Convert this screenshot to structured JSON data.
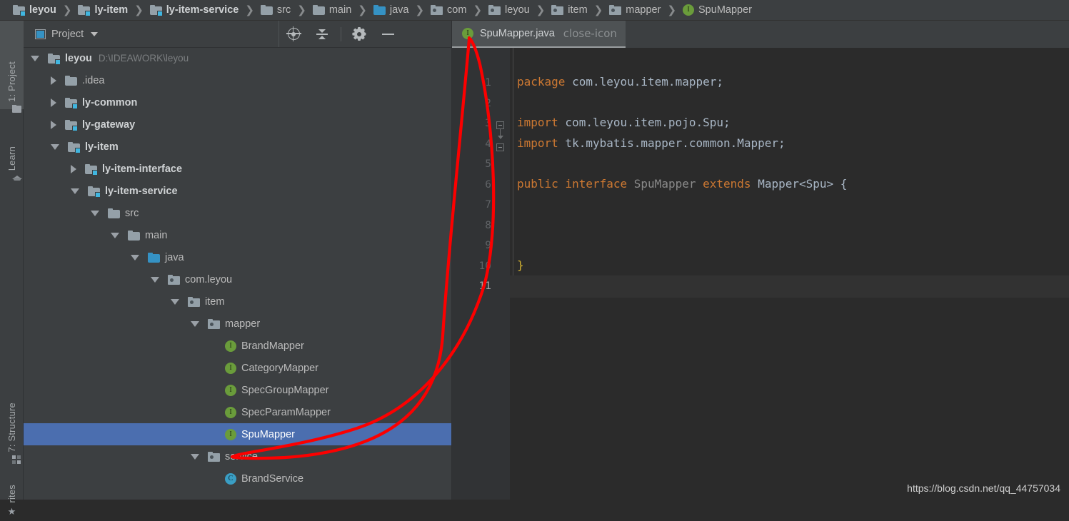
{
  "breadcrumb": [
    {
      "label": "leyou",
      "icon": "module-folder-icon",
      "bold": true
    },
    {
      "label": "ly-item",
      "icon": "module-folder-icon",
      "bold": true
    },
    {
      "label": "ly-item-service",
      "icon": "module-folder-icon",
      "bold": true
    },
    {
      "label": "src",
      "icon": "folder-icon",
      "bold": false
    },
    {
      "label": "main",
      "icon": "folder-icon",
      "bold": false
    },
    {
      "label": "java",
      "icon": "source-folder-icon",
      "bold": false
    },
    {
      "label": "com",
      "icon": "package-icon",
      "bold": false
    },
    {
      "label": "leyou",
      "icon": "package-icon",
      "bold": false
    },
    {
      "label": "item",
      "icon": "package-icon",
      "bold": false
    },
    {
      "label": "mapper",
      "icon": "package-icon",
      "bold": false
    },
    {
      "label": "SpuMapper",
      "icon": "interface-icon",
      "bold": false
    }
  ],
  "tool_strip": {
    "top_tabs": [
      {
        "label": "1: Project",
        "icon": "project-folder-icon",
        "active": true
      },
      {
        "label": "Learn",
        "icon": "graduation-cap-icon",
        "active": false
      }
    ],
    "bottom_tabs": [
      {
        "label": "7: Structure",
        "icon": "structure-icon",
        "active": false
      },
      {
        "label": "rites",
        "icon": "star-icon",
        "active": false
      }
    ]
  },
  "project_panel": {
    "title": "Project",
    "view_icon": "project-window-icon",
    "dropdown_icon": "chevron-down-icon",
    "toolbar": [
      {
        "name": "locate-file-button",
        "icon": "crosshair-icon"
      },
      {
        "name": "collapse-all-button",
        "icon": "collapse-all-icon"
      },
      {
        "name": "settings-button",
        "icon": "gear-icon"
      },
      {
        "name": "hide-button",
        "icon": "minus-icon"
      }
    ],
    "tree": [
      {
        "label": "leyou",
        "path": "D:\\IDEAWORK\\leyou",
        "depth": 0,
        "state": "expanded",
        "icon": "module-folder-icon",
        "bold": true,
        "selected": false
      },
      {
        "label": ".idea",
        "path": "",
        "depth": 1,
        "state": "collapsed",
        "icon": "folder-icon",
        "bold": false,
        "selected": false
      },
      {
        "label": "ly-common",
        "path": "",
        "depth": 1,
        "state": "collapsed",
        "icon": "module-folder-icon",
        "bold": true,
        "selected": false
      },
      {
        "label": "ly-gateway",
        "path": "",
        "depth": 1,
        "state": "collapsed",
        "icon": "module-folder-icon",
        "bold": true,
        "selected": false
      },
      {
        "label": "ly-item",
        "path": "",
        "depth": 1,
        "state": "expanded",
        "icon": "module-folder-icon",
        "bold": true,
        "selected": false
      },
      {
        "label": "ly-item-interface",
        "path": "",
        "depth": 2,
        "state": "collapsed",
        "icon": "module-folder-icon",
        "bold": true,
        "selected": false
      },
      {
        "label": "ly-item-service",
        "path": "",
        "depth": 2,
        "state": "expanded",
        "icon": "module-folder-icon",
        "bold": true,
        "selected": false
      },
      {
        "label": "src",
        "path": "",
        "depth": 3,
        "state": "expanded",
        "icon": "folder-icon",
        "bold": false,
        "selected": false
      },
      {
        "label": "main",
        "path": "",
        "depth": 4,
        "state": "expanded",
        "icon": "folder-icon",
        "bold": false,
        "selected": false
      },
      {
        "label": "java",
        "path": "",
        "depth": 5,
        "state": "expanded",
        "icon": "source-folder-icon",
        "bold": false,
        "selected": false
      },
      {
        "label": "com.leyou",
        "path": "",
        "depth": 6,
        "state": "expanded",
        "icon": "package-icon",
        "bold": false,
        "selected": false
      },
      {
        "label": "item",
        "path": "",
        "depth": 7,
        "state": "expanded",
        "icon": "package-icon",
        "bold": false,
        "selected": false
      },
      {
        "label": "mapper",
        "path": "",
        "depth": 8,
        "state": "expanded",
        "icon": "package-icon",
        "bold": false,
        "selected": false
      },
      {
        "label": "BrandMapper",
        "path": "",
        "depth": 9,
        "state": "leaf",
        "icon": "interface-icon",
        "bold": false,
        "selected": false
      },
      {
        "label": "CategoryMapper",
        "path": "",
        "depth": 9,
        "state": "leaf",
        "icon": "interface-icon",
        "bold": false,
        "selected": false
      },
      {
        "label": "SpecGroupMapper",
        "path": "",
        "depth": 9,
        "state": "leaf",
        "icon": "interface-icon",
        "bold": false,
        "selected": false
      },
      {
        "label": "SpecParamMapper",
        "path": "",
        "depth": 9,
        "state": "leaf",
        "icon": "interface-icon",
        "bold": false,
        "selected": false
      },
      {
        "label": "SpuMapper",
        "path": "",
        "depth": 9,
        "state": "leaf",
        "icon": "interface-icon",
        "bold": false,
        "selected": true
      },
      {
        "label": "service",
        "path": "",
        "depth": 8,
        "state": "expanded",
        "icon": "package-icon",
        "bold": false,
        "selected": false
      },
      {
        "label": "BrandService",
        "path": "",
        "depth": 9,
        "state": "leaf",
        "icon": "class-icon",
        "bold": false,
        "selected": false
      }
    ]
  },
  "editor": {
    "tab": {
      "label": "SpuMapper.java",
      "icon": "interface-icon",
      "close_icon": "close-icon"
    },
    "line_numbers": [
      "1",
      "2",
      "3",
      "4",
      "5",
      "6",
      "7",
      "8",
      "9",
      "10",
      "11"
    ],
    "caret_line": 11,
    "code_lines": [
      {
        "n": 1,
        "tokens": [
          {
            "t": "package",
            "c": "kw"
          },
          {
            "t": " com.leyou.item.mapper;",
            "c": "id"
          }
        ]
      },
      {
        "n": 2,
        "tokens": []
      },
      {
        "n": 3,
        "tokens": [
          {
            "t": "import",
            "c": "kw"
          },
          {
            "t": " com.leyou.item.pojo.Spu;",
            "c": "id"
          }
        ]
      },
      {
        "n": 4,
        "tokens": [
          {
            "t": "import",
            "c": "kw"
          },
          {
            "t": " tk.mybatis.mapper.common.Mapper;",
            "c": "id"
          }
        ]
      },
      {
        "n": 5,
        "tokens": []
      },
      {
        "n": 6,
        "tokens": [
          {
            "t": "public",
            "c": "kw"
          },
          {
            "t": " ",
            "c": "id"
          },
          {
            "t": "interface",
            "c": "kw"
          },
          {
            "t": " ",
            "c": "id"
          },
          {
            "t": "SpuMapper",
            "c": "cls"
          },
          {
            "t": " ",
            "c": "id"
          },
          {
            "t": "extends",
            "c": "kw"
          },
          {
            "t": " Mapper<Spu> {",
            "c": "id"
          }
        ]
      },
      {
        "n": 7,
        "tokens": []
      },
      {
        "n": 8,
        "tokens": []
      },
      {
        "n": 9,
        "tokens": []
      },
      {
        "n": 10,
        "tokens": [
          {
            "t": "}",
            "c": "yellow"
          }
        ]
      },
      {
        "n": 11,
        "tokens": []
      }
    ]
  },
  "annotation": {
    "color": "#fc0000",
    "shape": "loop-arrow-from-tab-to-spumapper-node"
  },
  "watermark": "https://blog.csdn.net/qq_44757034",
  "colors": {
    "panel_bg": "#3c3f41",
    "editor_bg": "#2b2b2b",
    "gutter_bg": "#313335",
    "selection_blue": "#4b6eaf",
    "keyword_orange": "#cc7832",
    "text_gray": "#a9b7c6",
    "interface_green": "#6a9c3b",
    "class_blue": "#3a9ec4",
    "annotation_red": "#fc0000"
  }
}
